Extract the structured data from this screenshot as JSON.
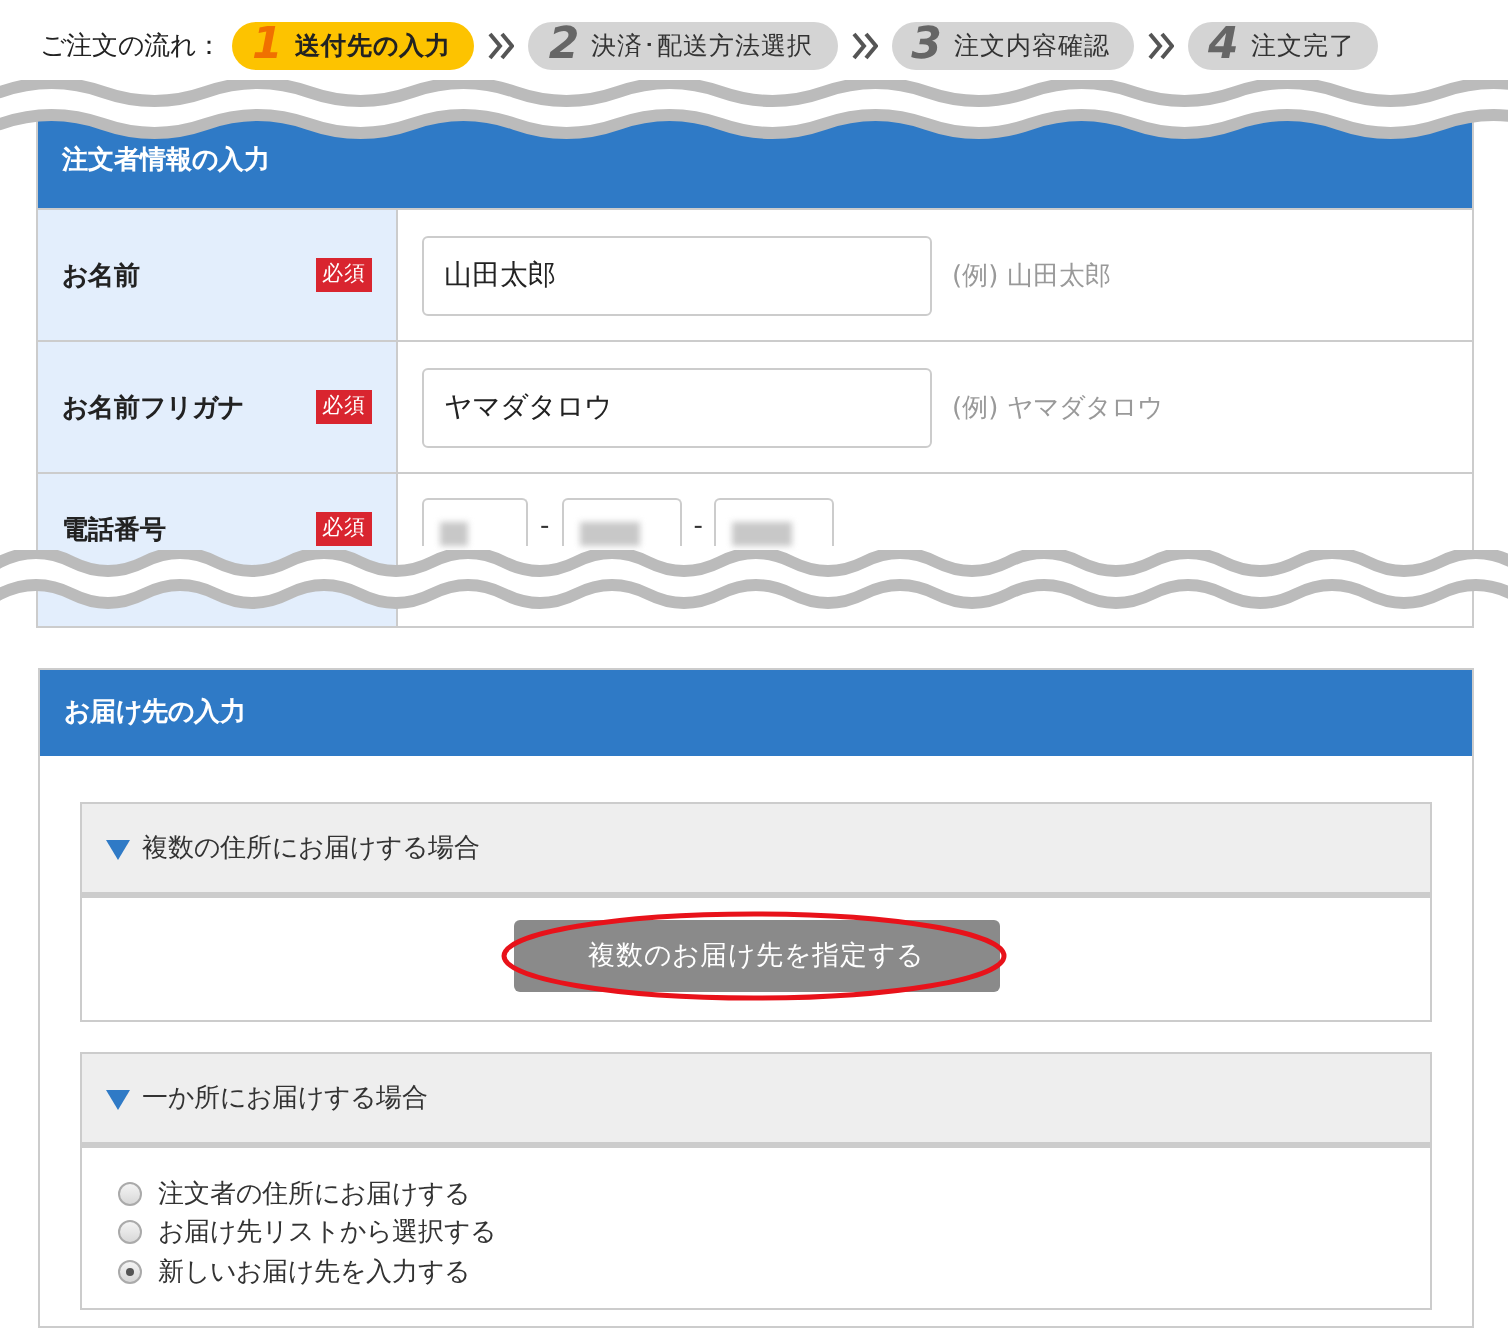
{
  "breadcrumb": {
    "label": "ご注文の流れ：",
    "steps": [
      {
        "number": "1",
        "label": "送付先の入力",
        "selected": true
      },
      {
        "number": "2",
        "label": "決済･配送方法選択",
        "selected": false
      },
      {
        "number": "3",
        "label": "注文内容確認",
        "selected": false
      },
      {
        "number": "4",
        "label": "注文完了",
        "selected": false
      }
    ]
  },
  "orderer_section": {
    "title": "注文者情報の入力",
    "rows": [
      {
        "kind": "text",
        "label": "お名前",
        "required_badge": "必須",
        "value": "山田太郎",
        "example": "(例) 山田太郎"
      },
      {
        "kind": "text",
        "label": "お名前フリガナ",
        "required_badge": "必須",
        "value": "ヤマダタロウ",
        "example": "(例) ヤマダタロウ"
      },
      {
        "kind": "phone",
        "label": "電話番号",
        "required_badge": "必須",
        "fields": [
          {
            "blurred": true
          },
          {
            "separator": "-",
            "blurred": true
          },
          {
            "separator": "-",
            "blurred": true
          }
        ]
      }
    ]
  },
  "delivery_section": {
    "title": "お届け先の入力",
    "boxes": [
      {
        "kind": "button",
        "title": "複数の住所にお届けする場合",
        "button": {
          "label": "複数のお届け先を指定する",
          "highlighted": true
        }
      },
      {
        "kind": "radios",
        "title": "一か所にお届けする場合",
        "options": [
          {
            "label": "注文者の住所にお届けする",
            "selected": false
          },
          {
            "label": "お届け先リストから選択する",
            "selected": false
          },
          {
            "label": "新しいお届け先を入力する",
            "selected": true
          }
        ]
      }
    ]
  }
}
